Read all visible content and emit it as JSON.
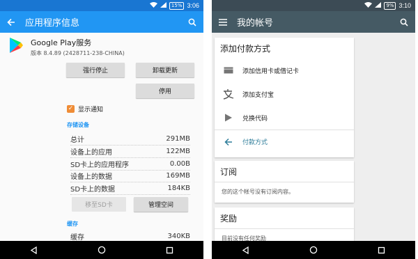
{
  "left": {
    "status": {
      "battery": "15%",
      "time": "3:06"
    },
    "toolbar": {
      "title": "应用程序信息"
    },
    "app": {
      "name": "Google Play服务",
      "version": "版本 8.4.89 (2428711-238-CHINA)"
    },
    "buttons": {
      "force_stop": "强行停止",
      "uninstall_updates": "卸载更新",
      "disable": "停用",
      "move_to_sd": "移至SD卡",
      "manage_space": "管理空间"
    },
    "notifications": {
      "label": "显示通知",
      "checked": true
    },
    "storage": {
      "title": "存储设备",
      "rows": [
        {
          "label": "总计",
          "value": "291MB"
        },
        {
          "label": "设备上的应用",
          "value": "122MB"
        },
        {
          "label": "SD卡上的应用程序",
          "value": "0.00B"
        },
        {
          "label": "设备上的数据",
          "value": "169MB"
        },
        {
          "label": "SD卡上的数据",
          "value": "184KB"
        }
      ]
    },
    "cache": {
      "title": "缓存",
      "row": {
        "label": "缓存",
        "value": "340KB"
      }
    }
  },
  "right": {
    "status": {
      "battery": "9%",
      "time": "3:10"
    },
    "toolbar": {
      "title": "我的帐号"
    },
    "payment": {
      "header": "添加付款方式",
      "items": [
        {
          "label": "添加信用卡或借记卡",
          "icon": "credit-card-icon"
        },
        {
          "label": "添加支付宝",
          "icon": "alipay-icon"
        },
        {
          "label": "兑换代码",
          "icon": "play-icon"
        },
        {
          "label": "付款方式",
          "icon": "arrow-back-icon",
          "accent": "#2e7d9a"
        }
      ]
    },
    "subscriptions": {
      "header": "订阅",
      "note": "您的这个帐号没有订阅内容。"
    },
    "rewards": {
      "header": "奖励",
      "note": "目前没有任何奖励"
    }
  },
  "colors": {
    "left_statusbar": "#1976d2",
    "left_toolbar": "#2196f3",
    "right_statusbar": "#3c4b55",
    "right_toolbar": "#455a64",
    "accent_orange": "#ef8c36"
  }
}
